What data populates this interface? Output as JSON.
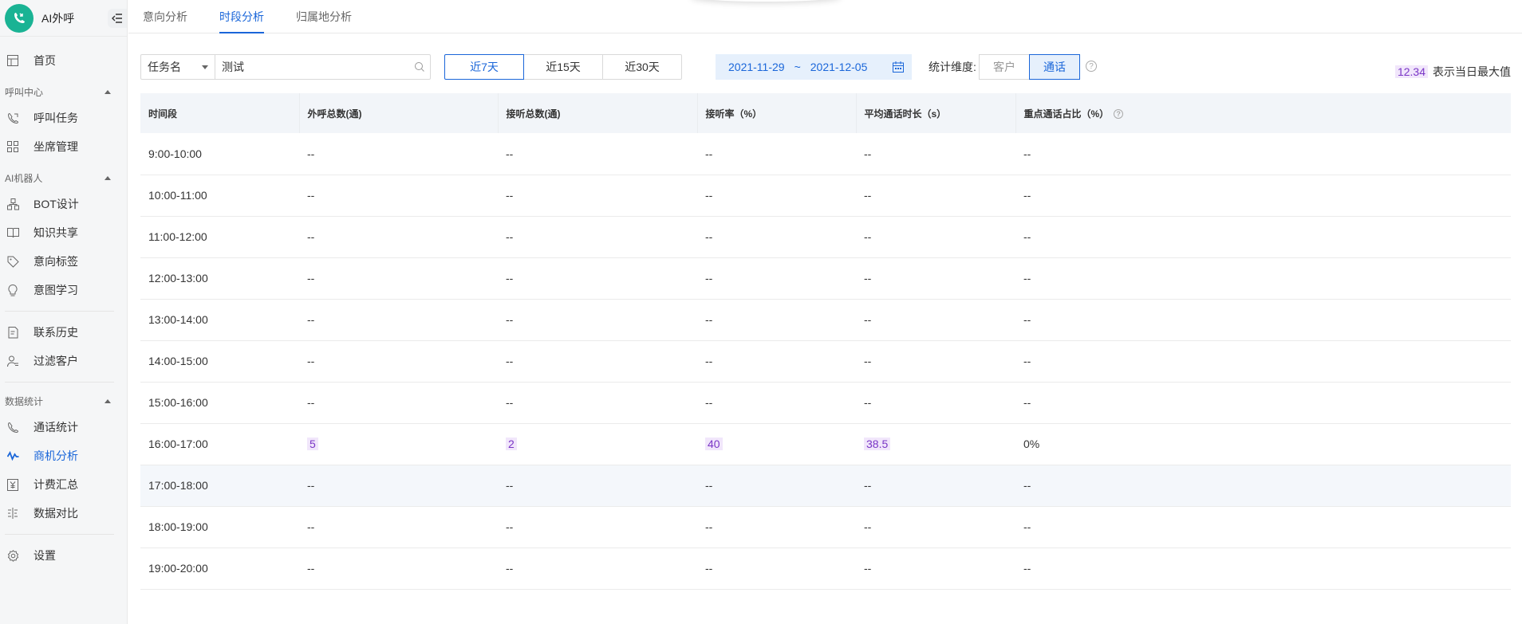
{
  "app": {
    "name": "AI外呼"
  },
  "sidebar": {
    "items": [
      {
        "label": "首页"
      },
      {
        "group": "呼叫中心"
      },
      {
        "label": "呼叫任务"
      },
      {
        "label": "坐席管理"
      },
      {
        "group": "AI机器人"
      },
      {
        "label": "BOT设计"
      },
      {
        "label": "知识共享"
      },
      {
        "label": "意向标签"
      },
      {
        "label": "意图学习"
      },
      {
        "label": "联系历史"
      },
      {
        "label": "过滤客户"
      },
      {
        "group": "数据统计"
      },
      {
        "label": "通话统计"
      },
      {
        "label": "商机分析"
      },
      {
        "label": "计费汇总"
      },
      {
        "label": "数据对比"
      },
      {
        "label": "设置"
      }
    ]
  },
  "tabs": [
    {
      "label": "意向分析"
    },
    {
      "label": "时段分析"
    },
    {
      "label": "归属地分析"
    }
  ],
  "filters": {
    "task_select": "任务名",
    "task_value": "测试",
    "ranges": [
      "近7天",
      "近15天",
      "近30天"
    ],
    "date_start": "2021-11-29",
    "date_sep": "~",
    "date_end": "2021-12-05",
    "dimension_label": "统计维度:",
    "dimensions": [
      "客户",
      "通话"
    ],
    "legend_value": "12.34",
    "legend_text": "表示当日最大值"
  },
  "table": {
    "headers": [
      "时间段",
      "外呼总数(通)",
      "接听总数(通)",
      "接听率（%）",
      "平均通话时长（s）",
      "重点通话占比（%）"
    ],
    "rows": [
      [
        "9:00-10:00",
        "--",
        "--",
        "--",
        "--",
        "--"
      ],
      [
        "10:00-11:00",
        "--",
        "--",
        "--",
        "--",
        "--"
      ],
      [
        "11:00-12:00",
        "--",
        "--",
        "--",
        "--",
        "--"
      ],
      [
        "12:00-13:00",
        "--",
        "--",
        "--",
        "--",
        "--"
      ],
      [
        "13:00-14:00",
        "--",
        "--",
        "--",
        "--",
        "--"
      ],
      [
        "14:00-15:00",
        "--",
        "--",
        "--",
        "--",
        "--"
      ],
      [
        "15:00-16:00",
        "--",
        "--",
        "--",
        "--",
        "--"
      ],
      [
        "16:00-17:00",
        "5",
        "2",
        "40",
        "38.5",
        "0%"
      ],
      [
        "17:00-18:00",
        "--",
        "--",
        "--",
        "--",
        "--"
      ],
      [
        "18:00-19:00",
        "--",
        "--",
        "--",
        "--",
        "--"
      ],
      [
        "19:00-20:00",
        "--",
        "--",
        "--",
        "--",
        "--"
      ]
    ]
  },
  "colors": {
    "accent": "#1a66d9",
    "highlight_bg": "#f1e6fb",
    "highlight_text": "#7a36c6"
  }
}
